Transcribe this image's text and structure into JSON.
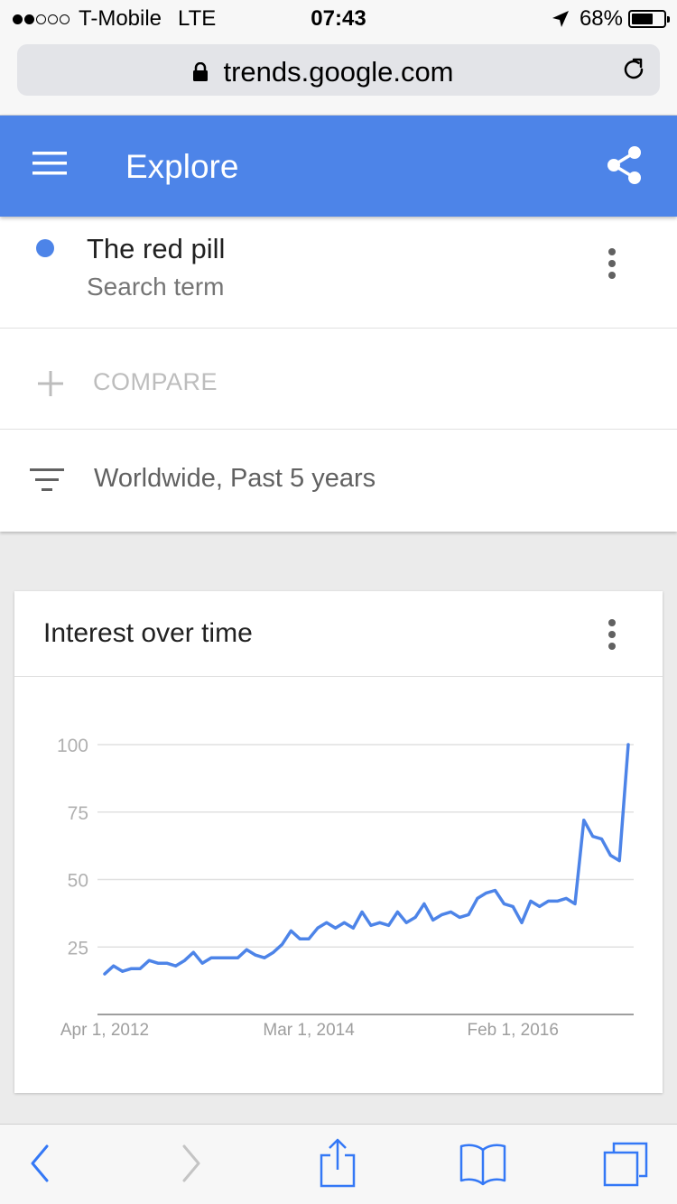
{
  "status_bar": {
    "signal_bars": 2,
    "signal_total": 5,
    "carrier": "T-Mobile",
    "network": "LTE",
    "time": "07:43",
    "battery": "68%",
    "battery_level": 0.68
  },
  "browser": {
    "url": "trends.google.com"
  },
  "app_bar": {
    "title": "Explore"
  },
  "search_term": {
    "name": "The red pill",
    "type": "Search term",
    "color": "#4d84e8"
  },
  "compare": {
    "label": "COMPARE"
  },
  "filter": {
    "label": "Worldwide, Past 5 years"
  },
  "chart_card": {
    "title": "Interest over time"
  },
  "chart_data": {
    "type": "line",
    "ylim": [
      0,
      100
    ],
    "yticks": [
      "100",
      "75",
      "50",
      "25"
    ],
    "ytick_values": [
      100,
      75,
      50,
      25
    ],
    "xticks": [
      "Apr 1, 2012",
      "Mar 1, 2014",
      "Feb 1, 2016"
    ],
    "xtick_positions": [
      0,
      23,
      46
    ],
    "grid": true,
    "line_color": "#4d84e8",
    "series": [
      {
        "values": [
          15,
          18,
          16,
          17,
          17,
          20,
          19,
          19,
          18,
          20,
          23,
          19,
          21,
          21,
          21,
          21,
          24,
          22,
          21,
          23,
          26,
          31,
          28,
          28,
          32,
          34,
          32,
          34,
          32,
          38,
          33,
          34,
          33,
          38,
          34,
          36,
          41,
          35,
          37,
          38,
          36,
          37,
          43,
          45,
          46,
          41,
          40,
          34,
          42,
          40,
          42,
          42,
          43,
          41,
          72,
          66,
          65,
          59,
          57,
          100
        ]
      }
    ]
  }
}
